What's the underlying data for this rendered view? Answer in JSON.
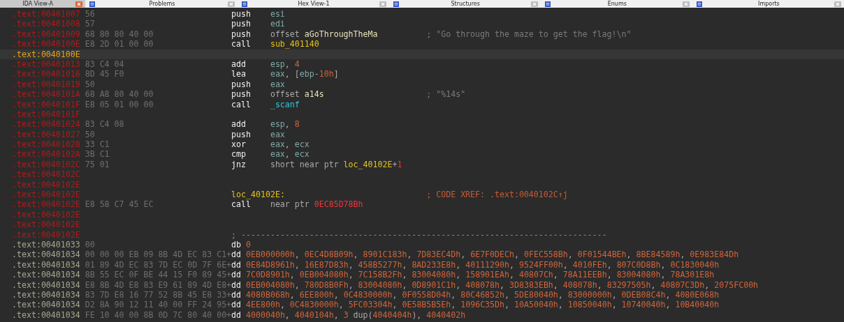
{
  "tabs": [
    {
      "label": "IDA View-A",
      "selected": true
    },
    {
      "label": "Problems",
      "selected": false
    },
    {
      "label": "Hex View-1",
      "selected": false
    },
    {
      "label": "Structures",
      "selected": false
    },
    {
      "label": "Enums",
      "selected": false
    },
    {
      "label": "Imports",
      "selected": false
    }
  ],
  "listing": [
    {
      "kind": "code",
      "selected": false,
      "address": ".text:00401007",
      "bytes": "56",
      "mnemonic": "push",
      "operands": [
        {
          "text": "esi",
          "kind": "reg"
        }
      ]
    },
    {
      "kind": "code",
      "selected": false,
      "address": ".text:00401008",
      "bytes": "57",
      "mnemonic": "push",
      "operands": [
        {
          "text": "edi",
          "kind": "reg"
        }
      ]
    },
    {
      "kind": "code",
      "selected": false,
      "address": ".text:00401009",
      "bytes": "68 80 80 40 00",
      "mnemonic": "push",
      "operands": [
        {
          "text": "offset ",
          "kind": "plain"
        },
        {
          "text": "aGoThroughTheMa",
          "kind": "strname"
        }
      ],
      "comment": {
        "text": "; \"Go through the maze to get the flag!\\n\"",
        "kind": "string"
      }
    },
    {
      "kind": "code",
      "selected": false,
      "address": ".text:0040100E",
      "bytes": "E8 2D 01 00 00",
      "mnemonic": "call",
      "operands": [
        {
          "text": "sub_401140",
          "kind": "name"
        }
      ]
    },
    {
      "kind": "blank",
      "selected": true,
      "address": ".text:0040100E"
    },
    {
      "kind": "code",
      "selected": false,
      "address": ".text:00401013",
      "bytes": "83 C4 04",
      "mnemonic": "add",
      "operands": [
        {
          "text": "esp",
          "kind": "reg"
        },
        {
          "text": ", ",
          "kind": "plain"
        },
        {
          "text": "4",
          "kind": "num"
        }
      ]
    },
    {
      "kind": "code",
      "selected": false,
      "address": ".text:00401016",
      "bytes": "8D 45 F0",
      "mnemonic": "lea",
      "operands": [
        {
          "text": "eax",
          "kind": "reg"
        },
        {
          "text": ", [",
          "kind": "plain"
        },
        {
          "text": "ebp",
          "kind": "reg"
        },
        {
          "text": "-",
          "kind": "plain"
        },
        {
          "text": "10h",
          "kind": "num"
        },
        {
          "text": "]",
          "kind": "plain"
        }
      ]
    },
    {
      "kind": "code",
      "selected": false,
      "address": ".text:00401019",
      "bytes": "50",
      "mnemonic": "push",
      "operands": [
        {
          "text": "eax",
          "kind": "reg"
        }
      ]
    },
    {
      "kind": "code",
      "selected": false,
      "address": ".text:0040101A",
      "bytes": "68 A8 80 40 00",
      "mnemonic": "push",
      "operands": [
        {
          "text": "offset ",
          "kind": "plain"
        },
        {
          "text": "a14s",
          "kind": "strname"
        }
      ],
      "comment": {
        "text": "; \"%14s\"",
        "kind": "string"
      }
    },
    {
      "kind": "code",
      "selected": false,
      "address": ".text:0040101F",
      "bytes": "E8 05 01 00 00",
      "mnemonic": "call",
      "operands": [
        {
          "text": "_scanf",
          "kind": "lib"
        }
      ]
    },
    {
      "kind": "blank",
      "selected": false,
      "address": ".text:0040101F"
    },
    {
      "kind": "code",
      "selected": false,
      "address": ".text:00401024",
      "bytes": "83 C4 08",
      "mnemonic": "add",
      "operands": [
        {
          "text": "esp",
          "kind": "reg"
        },
        {
          "text": ", ",
          "kind": "plain"
        },
        {
          "text": "8",
          "kind": "num"
        }
      ]
    },
    {
      "kind": "code",
      "selected": false,
      "address": ".text:00401027",
      "bytes": "50",
      "mnemonic": "push",
      "operands": [
        {
          "text": "eax",
          "kind": "reg"
        }
      ]
    },
    {
      "kind": "code",
      "selected": false,
      "address": ".text:00401028",
      "bytes": "33 C1",
      "mnemonic": "xor",
      "operands": [
        {
          "text": "eax",
          "kind": "reg"
        },
        {
          "text": ", ",
          "kind": "plain"
        },
        {
          "text": "ecx",
          "kind": "reg"
        }
      ]
    },
    {
      "kind": "code",
      "selected": false,
      "address": ".text:0040102A",
      "bytes": "3B C1",
      "mnemonic": "cmp",
      "operands": [
        {
          "text": "eax",
          "kind": "reg"
        },
        {
          "text": ", ",
          "kind": "plain"
        },
        {
          "text": "ecx",
          "kind": "reg"
        }
      ]
    },
    {
      "kind": "code",
      "selected": false,
      "address": ".text:0040102C",
      "bytes": "75 01",
      "mnemonic": "jnz",
      "operands": [
        {
          "text": "short near ptr ",
          "kind": "plain"
        },
        {
          "text": "loc_40102E",
          "kind": "name"
        },
        {
          "text": "+",
          "kind": "plain"
        },
        {
          "text": "1",
          "kind": "bad"
        }
      ]
    },
    {
      "kind": "blank",
      "selected": false,
      "address": ".text:0040102C"
    },
    {
      "kind": "blank",
      "selected": false,
      "address": ".text:0040102E"
    },
    {
      "kind": "label",
      "selected": false,
      "address": ".text:0040102E",
      "label": "loc_40102E:",
      "comment": {
        "text": "; CODE XREF: .text:0040102C↑j",
        "kind": "xref"
      }
    },
    {
      "kind": "code",
      "selected": false,
      "address": ".text:0040102E",
      "bytes": "E8 58 C7 45 EC",
      "mnemonic": "call",
      "operands": [
        {
          "text": "near ptr ",
          "kind": "plain"
        },
        {
          "text": "0EC85D78Bh",
          "kind": "bad"
        }
      ]
    },
    {
      "kind": "blank",
      "selected": false,
      "address": ".text:0040102E"
    },
    {
      "kind": "blank",
      "selected": false,
      "address": ".text:0040102E"
    },
    {
      "kind": "separator",
      "selected": false,
      "address": ".text:0040102E",
      "text": "; ---------------------------------------------------------------------------"
    },
    {
      "kind": "data",
      "selected": false,
      "address": ".text:00401033",
      "bytes": "00",
      "mnemonic": "db",
      "operands": [
        {
          "text": "0",
          "kind": "num"
        }
      ]
    },
    {
      "kind": "data",
      "selected": false,
      "address": ".text:00401034",
      "bytes": "00 00 00 EB 09 8B 4D EC 83 C1+",
      "mnemonic": "dd",
      "operands": [
        {
          "text": "0EB000000h",
          "kind": "num"
        },
        {
          "text": ", ",
          "kind": "plain"
        },
        {
          "text": "0EC4D8B09h",
          "kind": "num"
        },
        {
          "text": ", ",
          "kind": "plain"
        },
        {
          "text": "8901C183h",
          "kind": "num"
        },
        {
          "text": ", ",
          "kind": "plain"
        },
        {
          "text": "7D83EC4Dh",
          "kind": "num"
        },
        {
          "text": ", ",
          "kind": "plain"
        },
        {
          "text": "6E7F0DECh",
          "kind": "num"
        },
        {
          "text": ", ",
          "kind": "plain"
        },
        {
          "text": "0FEC558Bh",
          "kind": "num"
        },
        {
          "text": ", ",
          "kind": "plain"
        },
        {
          "text": "0F01544BEh",
          "kind": "num"
        },
        {
          "text": ", ",
          "kind": "plain"
        },
        {
          "text": "8BE84589h",
          "kind": "num"
        },
        {
          "text": ", ",
          "kind": "plain"
        },
        {
          "text": "0E983E84Dh",
          "kind": "num"
        }
      ]
    },
    {
      "kind": "data",
      "selected": false,
      "address": ".text:00401034",
      "bytes": "01 89 4D EC 83 7D EC 0D 7F 6E+",
      "mnemonic": "dd",
      "operands": [
        {
          "text": "0E84D8961h",
          "kind": "num"
        },
        {
          "text": ", ",
          "kind": "plain"
        },
        {
          "text": "16E87D83h",
          "kind": "num"
        },
        {
          "text": ", ",
          "kind": "plain"
        },
        {
          "text": "458B5277h",
          "kind": "num"
        },
        {
          "text": ", ",
          "kind": "plain"
        },
        {
          "text": "8AD233E8h",
          "kind": "num"
        },
        {
          "text": ", ",
          "kind": "plain"
        },
        {
          "text": "40111290h",
          "kind": "num"
        },
        {
          "text": ", ",
          "kind": "plain"
        },
        {
          "text": "9524FF00h",
          "kind": "num"
        },
        {
          "text": ", ",
          "kind": "plain"
        },
        {
          "text": "4010FEh",
          "kind": "num"
        },
        {
          "text": ", ",
          "kind": "plain"
        },
        {
          "text": "807C0D8Bh",
          "kind": "num"
        },
        {
          "text": ", ",
          "kind": "plain"
        },
        {
          "text": "0C1830040h",
          "kind": "num"
        }
      ]
    },
    {
      "kind": "data",
      "selected": false,
      "address": ".text:00401034",
      "bytes": "8B 55 EC 0F BE 44 15 F0 89 45+",
      "mnemonic": "dd",
      "operands": [
        {
          "text": "7C0D8901h",
          "kind": "num"
        },
        {
          "text": ", ",
          "kind": "plain"
        },
        {
          "text": "0EB004080h",
          "kind": "num"
        },
        {
          "text": ", ",
          "kind": "plain"
        },
        {
          "text": "7C158B2Fh",
          "kind": "num"
        },
        {
          "text": ", ",
          "kind": "plain"
        },
        {
          "text": "83004080h",
          "kind": "num"
        },
        {
          "text": ", ",
          "kind": "plain"
        },
        {
          "text": "158901EAh",
          "kind": "num"
        },
        {
          "text": ", ",
          "kind": "plain"
        },
        {
          "text": "40807Ch",
          "kind": "num"
        },
        {
          "text": ", ",
          "kind": "plain"
        },
        {
          "text": "78A11EEBh",
          "kind": "num"
        },
        {
          "text": ", ",
          "kind": "plain"
        },
        {
          "text": "83004080h",
          "kind": "num"
        },
        {
          "text": ", ",
          "kind": "plain"
        },
        {
          "text": "78A301E8h",
          "kind": "num"
        }
      ]
    },
    {
      "kind": "data",
      "selected": false,
      "address": ".text:00401034",
      "bytes": "E8 8B 4D E8 83 E9 61 89 4D E8+",
      "mnemonic": "dd",
      "operands": [
        {
          "text": "0EB004080h",
          "kind": "num"
        },
        {
          "text": ", ",
          "kind": "plain"
        },
        {
          "text": "780D8B0Fh",
          "kind": "num"
        },
        {
          "text": ", ",
          "kind": "plain"
        },
        {
          "text": "83004080h",
          "kind": "num"
        },
        {
          "text": ", ",
          "kind": "plain"
        },
        {
          "text": "0D8901C1h",
          "kind": "num"
        },
        {
          "text": ", ",
          "kind": "plain"
        },
        {
          "text": "408078h",
          "kind": "num"
        },
        {
          "text": ", ",
          "kind": "plain"
        },
        {
          "text": "3D8383EBh",
          "kind": "num"
        },
        {
          "text": ", ",
          "kind": "plain"
        },
        {
          "text": "408078h",
          "kind": "num"
        },
        {
          "text": ", ",
          "kind": "plain"
        },
        {
          "text": "83297505h",
          "kind": "num"
        },
        {
          "text": ", ",
          "kind": "plain"
        },
        {
          "text": "40807C3Dh",
          "kind": "num"
        },
        {
          "text": ", ",
          "kind": "plain"
        },
        {
          "text": "2075FC00h",
          "kind": "num"
        }
      ]
    },
    {
      "kind": "data",
      "selected": false,
      "address": ".text:00401034",
      "bytes": "83 7D E8 16 77 52 8B 45 E8 33+",
      "mnemonic": "dd",
      "operands": [
        {
          "text": "4080B068h",
          "kind": "num"
        },
        {
          "text": ", ",
          "kind": "plain"
        },
        {
          "text": "6EE800h",
          "kind": "num"
        },
        {
          "text": ", ",
          "kind": "plain"
        },
        {
          "text": "0C4830000h",
          "kind": "num"
        },
        {
          "text": ", ",
          "kind": "plain"
        },
        {
          "text": "0F0558D04h",
          "kind": "num"
        },
        {
          "text": ", ",
          "kind": "plain"
        },
        {
          "text": "80C46852h",
          "kind": "num"
        },
        {
          "text": ", ",
          "kind": "plain"
        },
        {
          "text": "5DE80040h",
          "kind": "num"
        },
        {
          "text": ", ",
          "kind": "plain"
        },
        {
          "text": "83000000h",
          "kind": "num"
        },
        {
          "text": ", ",
          "kind": "plain"
        },
        {
          "text": "0DEB08C4h",
          "kind": "num"
        },
        {
          "text": ", ",
          "kind": "plain"
        },
        {
          "text": "4080E068h",
          "kind": "num"
        }
      ]
    },
    {
      "kind": "data",
      "selected": false,
      "address": ".text:00401034",
      "bytes": "D2 8A 90 12 11 40 00 FF 24 95+",
      "mnemonic": "dd",
      "operands": [
        {
          "text": "4EE800h",
          "kind": "num"
        },
        {
          "text": ", ",
          "kind": "plain"
        },
        {
          "text": "0C4830000h",
          "kind": "num"
        },
        {
          "text": ", ",
          "kind": "plain"
        },
        {
          "text": "5FC03304h",
          "kind": "num"
        },
        {
          "text": ", ",
          "kind": "plain"
        },
        {
          "text": "0E58B5B5Eh",
          "kind": "num"
        },
        {
          "text": ", ",
          "kind": "plain"
        },
        {
          "text": "1096C35Dh",
          "kind": "num"
        },
        {
          "text": ", ",
          "kind": "plain"
        },
        {
          "text": "10A50040h",
          "kind": "num"
        },
        {
          "text": ", ",
          "kind": "plain"
        },
        {
          "text": "10850040h",
          "kind": "num"
        },
        {
          "text": ", ",
          "kind": "plain"
        },
        {
          "text": "10740040h",
          "kind": "num"
        },
        {
          "text": ", ",
          "kind": "plain"
        },
        {
          "text": "10B40040h",
          "kind": "num"
        }
      ]
    },
    {
      "kind": "data",
      "selected": false,
      "address": ".text:00401034",
      "bytes": "FE 10 40 00 8B 0D 7C 80 40 00+",
      "mnemonic": "dd",
      "operands": [
        {
          "text": "4000040h",
          "kind": "num"
        },
        {
          "text": ", ",
          "kind": "plain"
        },
        {
          "text": "4040104h",
          "kind": "num"
        },
        {
          "text": ", ",
          "kind": "plain"
        },
        {
          "text": "3",
          "kind": "num"
        },
        {
          "text": " dup(",
          "kind": "plain"
        },
        {
          "text": "4040404h",
          "kind": "num"
        },
        {
          "text": "), ",
          "kind": "plain"
        },
        {
          "text": "4040402h",
          "kind": "num"
        }
      ]
    }
  ]
}
